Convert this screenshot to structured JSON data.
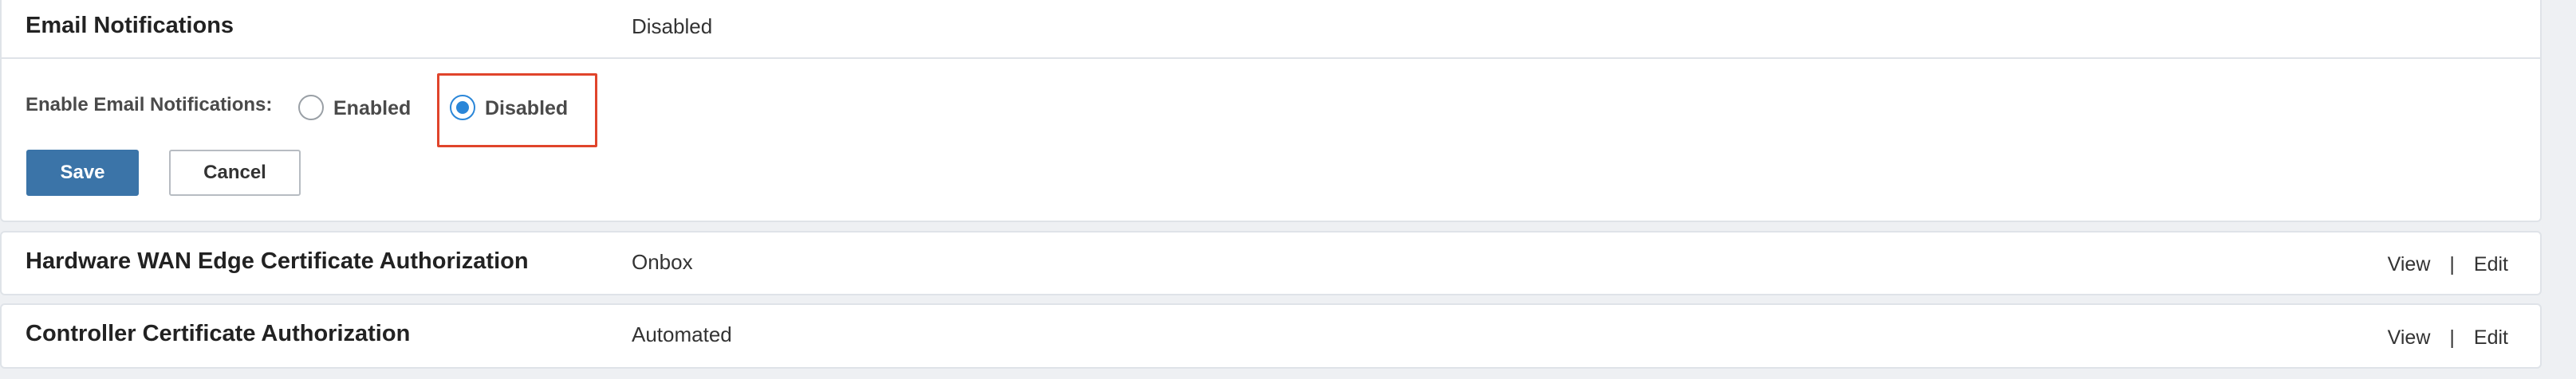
{
  "email_notifications": {
    "title": "Email Notifications",
    "value": "Disabled",
    "form": {
      "label": "Enable Email Notifications:",
      "options": [
        {
          "label": "Enabled",
          "checked": false
        },
        {
          "label": "Disabled",
          "checked": true
        }
      ],
      "save_label": "Save",
      "cancel_label": "Cancel"
    }
  },
  "hardware_wan_edge": {
    "title": "Hardware WAN Edge Certificate Authorization",
    "value": "Onbox",
    "view_label": "View",
    "separator": "|",
    "edit_label": "Edit"
  },
  "controller_cert": {
    "title": "Controller Certificate Authorization",
    "value": "Automated",
    "view_label": "View",
    "separator": "|",
    "edit_label": "Edit"
  },
  "colors": {
    "accent": "#2a86d8",
    "primary_button": "#3b74a8",
    "highlight": "#e0442b",
    "background": "#eef0f3"
  }
}
